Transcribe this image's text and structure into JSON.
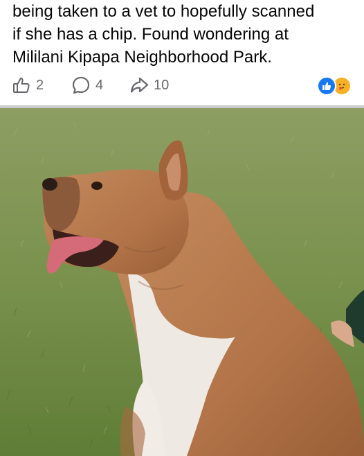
{
  "post": {
    "text_lines": [
      "being taken to a vet to hopefully scanned",
      "if she has a chip. Found wondering at",
      "Mililani Kipapa Neighborhood Park."
    ]
  },
  "actions": {
    "like_count": "2",
    "comment_count": "4",
    "share_count": "10"
  },
  "reactions": [
    "like-icon",
    "care-icon"
  ],
  "colors": {
    "icon_gray": "#65676b",
    "like_blue": "#1877f2",
    "care_yellow": "#f7b125",
    "divider": "#c9ccd1"
  }
}
